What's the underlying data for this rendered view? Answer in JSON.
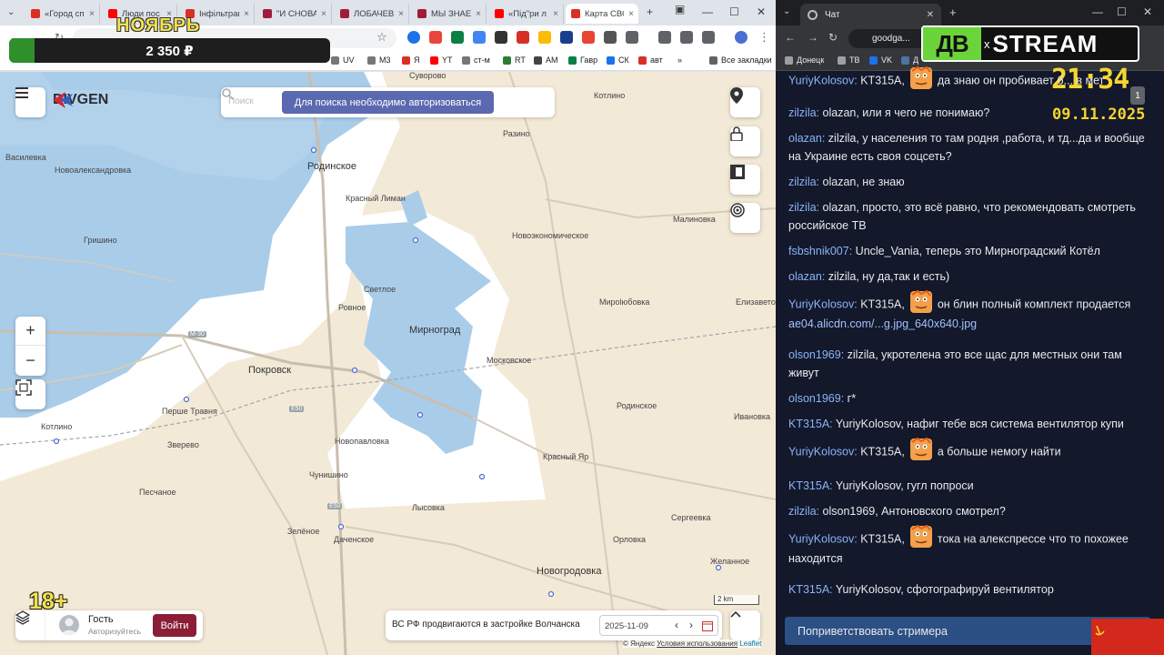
{
  "left_browser": {
    "tabs": [
      {
        "label": "«Город сп",
        "color": "#d93025"
      },
      {
        "label": "Люди пос",
        "color": "#ff0000"
      },
      {
        "label": "Інфільтрац",
        "color": "#d93025"
      },
      {
        "label": "\"И СНОВА",
        "color": "#a01c3c"
      },
      {
        "label": "ЛОБАЧЕВ",
        "color": "#a01c3c"
      },
      {
        "label": "МЫ ЗНАЕМ",
        "color": "#a01c3c"
      },
      {
        "label": "«Під\"ри л",
        "color": "#ff0000"
      },
      {
        "label": "Карта СВО",
        "color": "#d93025"
      }
    ],
    "bookmarks": [
      "UV",
      "M3",
      "Я",
      "YT",
      "ст-м",
      "RT",
      "AM",
      "Гавр",
      "СК",
      "авт",
      "Все закладки"
    ]
  },
  "promo": {
    "month": "НОЯБРЬ",
    "donation_amount": "2 350 ₽",
    "donation_progress_percent": 8
  },
  "map": {
    "logo_text": "DIVGEN",
    "search_placeholder": "Поиск",
    "auth_notice": "Для поиска необходимо авторизоваться",
    "zoom_in": "+",
    "zoom_out": "−",
    "user": {
      "name": "Гость",
      "subtitle": "Авторизуйтесь",
      "login_label": "Войти"
    },
    "age_badge": "18+",
    "news_text": "ВС РФ продвигаются в застройке Волчанска",
    "date_value": "2025-11-09",
    "scale_label": "2 km",
    "attribution": {
      "prefix": "© Яндекс",
      "terms": "Условия использования",
      "provider": "Leaflet"
    },
    "places": [
      {
        "name": "Суворово"
      },
      {
        "name": "Котлино"
      },
      {
        "name": "Родинское"
      },
      {
        "name": "Красный Лиман"
      },
      {
        "name": "Разино"
      },
      {
        "name": "Василевка"
      },
      {
        "name": "Новоалександровка"
      },
      {
        "name": "Гришино"
      },
      {
        "name": "Малиновка"
      },
      {
        "name": "Новоэкономическое"
      },
      {
        "name": "Светлое"
      },
      {
        "name": "Ровное"
      },
      {
        "name": "Мирноград"
      },
      {
        "name": "Мирolюбовка"
      },
      {
        "name": "Елизаветовка"
      },
      {
        "name": "Покровск"
      },
      {
        "name": "Московское"
      },
      {
        "name": "Родинское"
      },
      {
        "name": "Котлино"
      },
      {
        "name": "Перше Травня"
      },
      {
        "name": "Новопавловка"
      },
      {
        "name": "Ивановка"
      },
      {
        "name": "Зверево"
      },
      {
        "name": "Песчаное"
      },
      {
        "name": "Чунишино"
      },
      {
        "name": "Красный Яр"
      },
      {
        "name": "Лысовка"
      },
      {
        "name": "Сергеевка"
      },
      {
        "name": "Зелёное"
      },
      {
        "name": "Даченское"
      },
      {
        "name": "Орловка"
      },
      {
        "name": "Новогродовка"
      },
      {
        "name": "Желанное"
      }
    ],
    "road_labels": [
      "M-30",
      "E50",
      "E50"
    ]
  },
  "right_browser": {
    "tab_title": "Чат",
    "url": "goodga...",
    "bookmarks": [
      "Донецк",
      "ТВ",
      "VK",
      "Д"
    ]
  },
  "stream": {
    "logo_left": "ДВ",
    "logo_x": "x",
    "logo_right": "STREAM",
    "clock": "21:34",
    "date": "09.11.2025",
    "badge": "1"
  },
  "chat": {
    "messages": [
      {
        "user": "YuriyKolosov:",
        "pre": "KT315A,",
        "text": "да знаю он пробивает б... в мет",
        "emote": true
      },
      {
        "user": "zilzila:",
        "text": "olazan, или я чего не понимаю?"
      },
      {
        "user": "olazan:",
        "text": "zilzila, у населения то там родня ,работа, и тд...да и вообще на Украине есть своя соцсеть?"
      },
      {
        "user": "zilzila:",
        "text": "olazan, не знаю"
      },
      {
        "user": "zilzila:",
        "text": "olazan, просто, это всё равно, что рекомендовать смотреть российское ТВ"
      },
      {
        "user": "fsbshnik007:",
        "text": "Uncle_Vania, теперь это Мирноградский Котёл"
      },
      {
        "user": "olazan:",
        "text": "zilzila, ну да,так и есть)"
      },
      {
        "user": "YuriyKolosov:",
        "pre": "KT315A,",
        "text": "он блин полный комплект продается",
        "emote": true,
        "link": "ae04.alicdn.com/...g.jpg_640x640.jpg"
      },
      {
        "user": "olson1969:",
        "text": "zilzila, укротелена это все щас для местных они там живут"
      },
      {
        "user": "olson1969:",
        "text": "г*"
      },
      {
        "user": "KT315A:",
        "text": "YuriyKolosov, нафиг тебе вся система вентилятор купи"
      },
      {
        "user": "YuriyKolosov:",
        "pre": "KT315A,",
        "text": "а больше немогу найти",
        "emote": true
      },
      {
        "user": "KT315A:",
        "text": "YuriyKolosov, гугл попроси"
      },
      {
        "user": "zilzila:",
        "text": "olson1969, Антоновского смотрел?"
      },
      {
        "user": "YuriyKolosov:",
        "pre": "KT315A,",
        "text": "тока на алекспрессе что то похожее находится",
        "emote": true
      },
      {
        "user": "KT315A:",
        "text": "YuriyKolosov, сфотографируй вентилятор"
      }
    ],
    "greet_button": "Поприветствовать стримера"
  }
}
